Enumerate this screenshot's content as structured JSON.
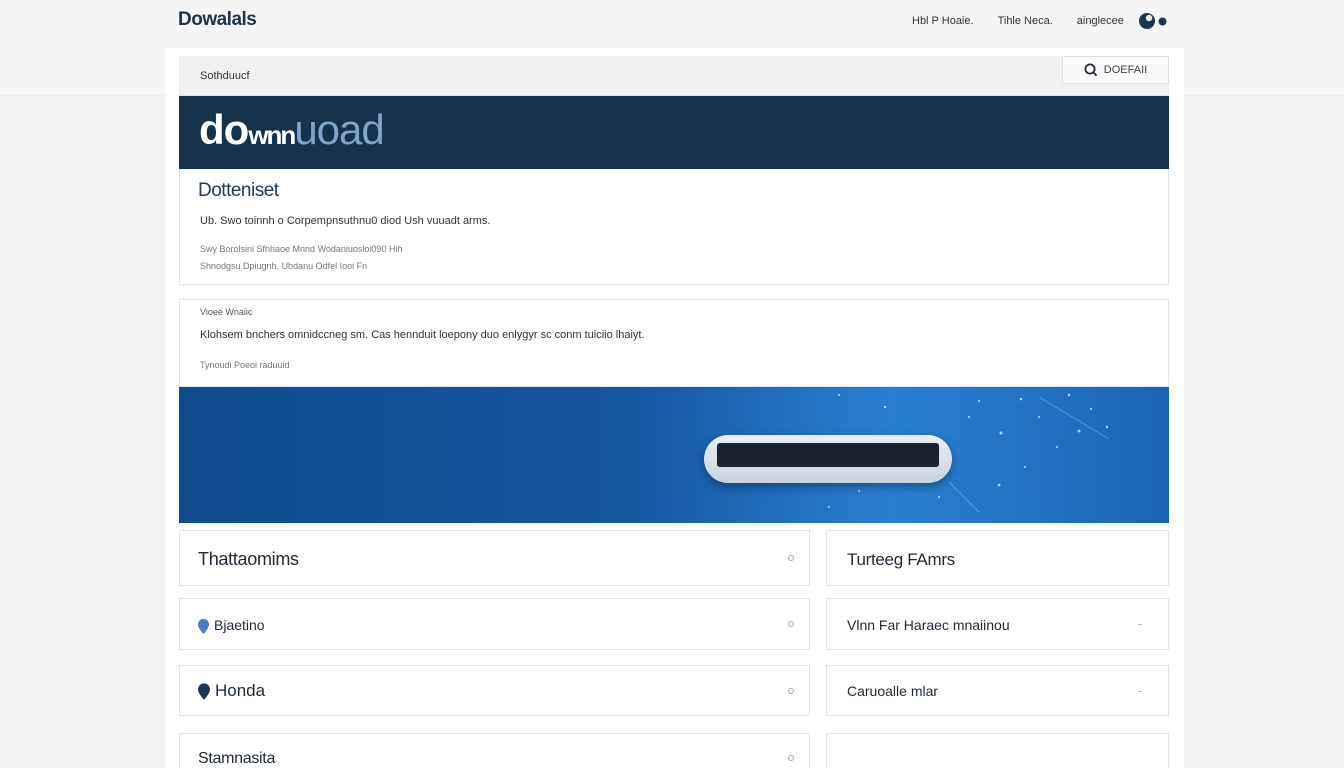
{
  "header": {
    "brand": "Dowalals",
    "nav": [
      "Hbl P Hoaie.",
      "Tihle Neca.",
      "ainglecee"
    ]
  },
  "search": {
    "value": "Sothduucf",
    "button_label": "DOEFAII"
  },
  "hero": {
    "text_main": "do",
    "text_mid": "wnn",
    "text_end": "uoad"
  },
  "summary_card": {
    "title": "Dotteniset",
    "line1": "Ub. Swo toinnh o Corpempnsuthnu0 diod  Ush vuuadt arms.",
    "line2": "Swy Borolsinl Sfhhaoe  Mnnd Wodaniuosloi090   Hih",
    "line3": "Shnodgsu Dpiugnh.  Ubdanu  Odfel Iooi Fn"
  },
  "detail_card": {
    "label": "Vioee Wnaiic",
    "description": "Klohsem bnchers omnidccneg sm. Cas hennduit loepony duo enlygyr sc conm tuiciio lhaiyt.",
    "meta": "Tynoudi  Poeoi raduuid"
  },
  "list_left": [
    {
      "label": "Thattaomims",
      "icon": ""
    },
    {
      "label": "Bjaetino",
      "icon": "pin-blue-icon"
    },
    {
      "label": "Honda",
      "icon": "pin-dark-icon"
    },
    {
      "label": "Stamnasita",
      "icon": ""
    }
  ],
  "list_right": [
    {
      "label": "Turteeg FAmrs"
    },
    {
      "label": "Vlnn Far Haraec mnaiinou"
    },
    {
      "label": "Caruoalle mlar"
    },
    {
      "label": ""
    }
  ],
  "colors": {
    "hero_bg": "#16324a",
    "banner": "#1556a0",
    "accent": "#4c78c9"
  }
}
